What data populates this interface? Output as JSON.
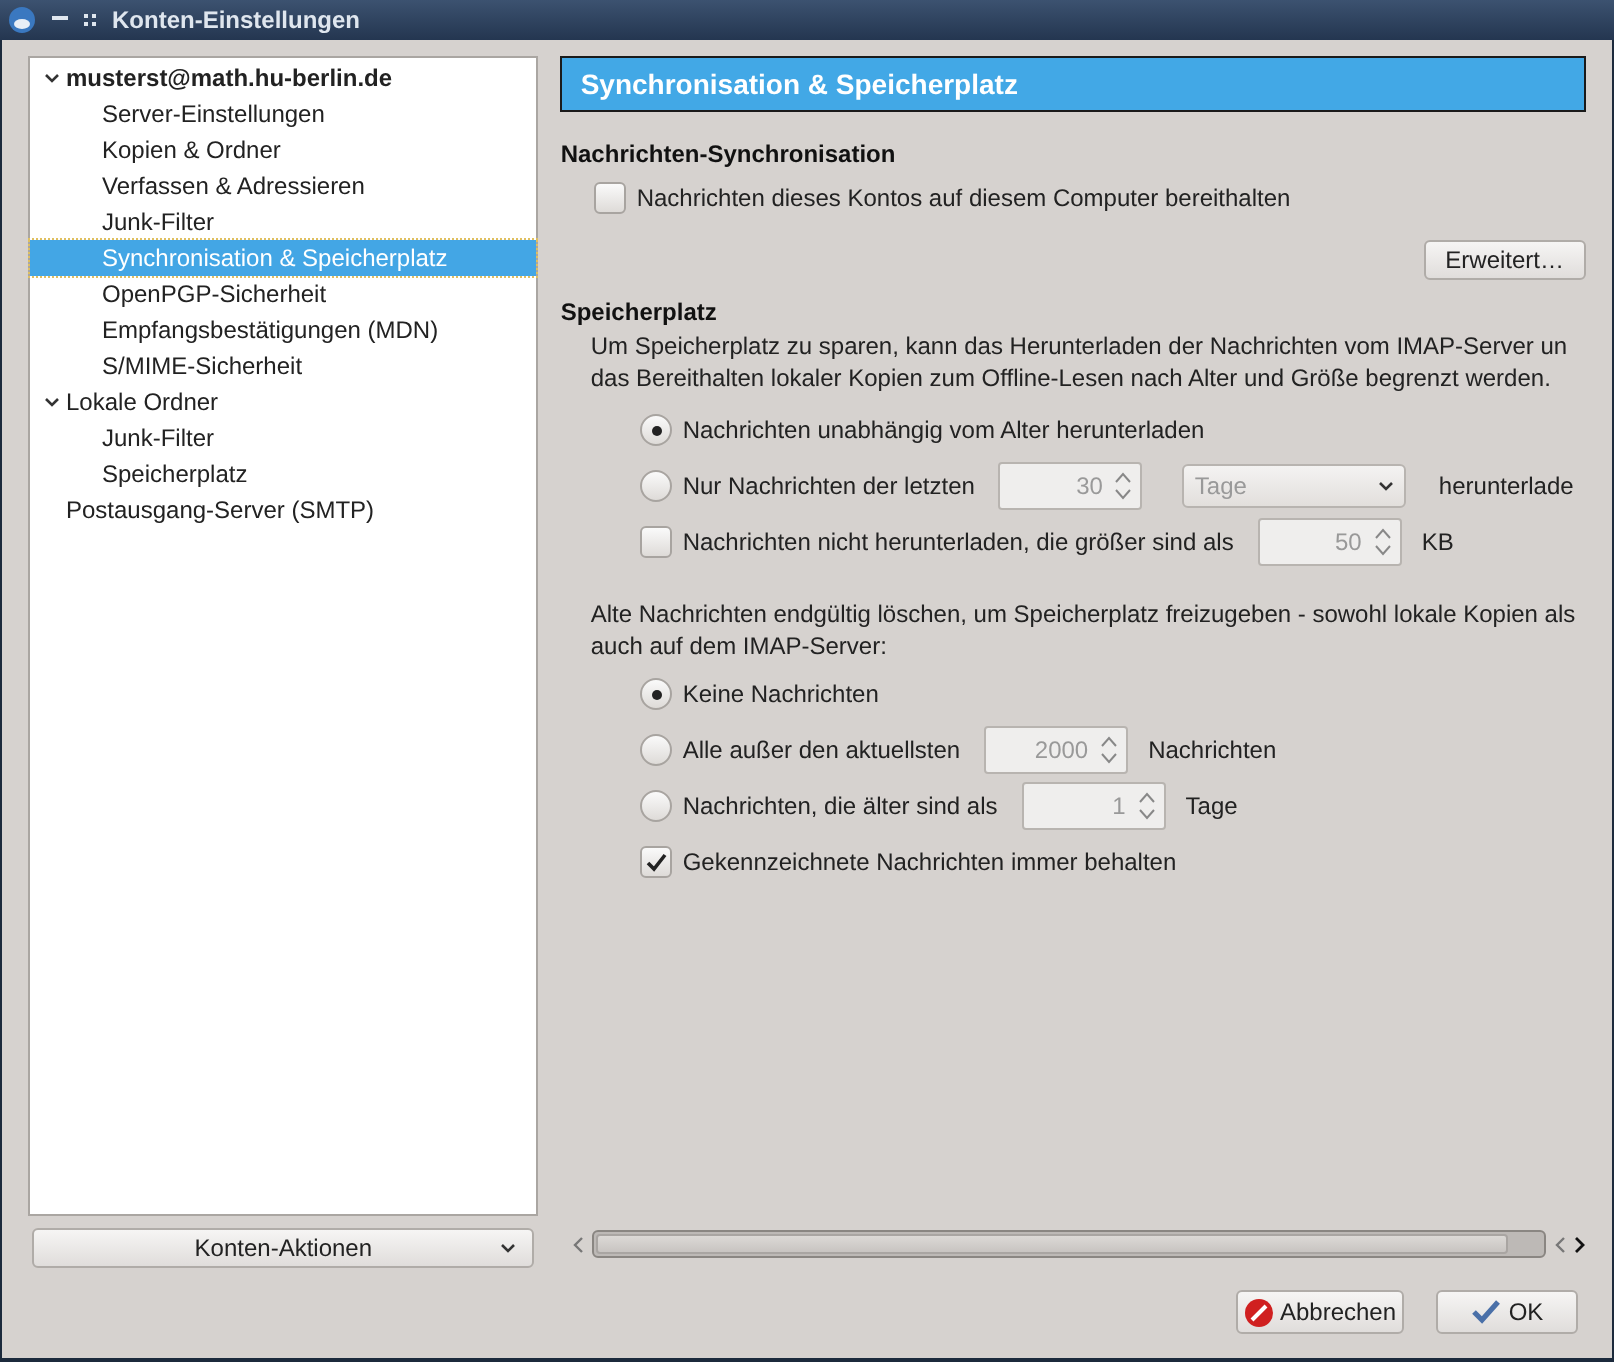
{
  "window": {
    "title": "Konten-Einstellungen"
  },
  "tree": [
    {
      "kind": "account",
      "label": "musterst@math.hu-berlin.de",
      "expanded": true,
      "selected": false,
      "children": [
        {
          "label": "Server-Einstellungen",
          "selected": false
        },
        {
          "label": "Kopien & Ordner",
          "selected": false
        },
        {
          "label": "Verfassen & Adressieren",
          "selected": false
        },
        {
          "label": "Junk-Filter",
          "selected": false
        },
        {
          "label": "Synchronisation & Speicherplatz",
          "selected": true
        },
        {
          "label": "OpenPGP-Sicherheit",
          "selected": false
        },
        {
          "label": "Empfangsbestätigungen (MDN)",
          "selected": false
        },
        {
          "label": "S/MIME-Sicherheit",
          "selected": false
        }
      ]
    },
    {
      "kind": "folder",
      "label": "Lokale Ordner",
      "expanded": true,
      "selected": false,
      "children": [
        {
          "label": "Junk-Filter",
          "selected": false
        },
        {
          "label": "Speicherplatz",
          "selected": false
        }
      ]
    },
    {
      "kind": "folder",
      "label": "Postausgang-Server (SMTP)",
      "selected": false
    }
  ],
  "account_actions": {
    "label": "Konten-Aktionen"
  },
  "page_header": "Synchronisation & Speicherplatz",
  "sync_section": {
    "heading": "Nachrichten-Synchronisation",
    "option": {
      "label": "Nachrichten dieses Kontos auf diesem Computer bereithalten",
      "checked": false
    },
    "advanced_button": "Erweitert…"
  },
  "storage_section": {
    "heading": "Speicherplatz",
    "description": "Um Speicherplatz zu sparen, kann das Herunterladen der Nachrichten vom IMAP-Server un das Bereithalten lokaler Kopien zum Offline-Lesen nach Alter und Größe begrenzt werden.",
    "download_options": [
      {
        "kind": "radio",
        "label": "Nachrichten unabhängig vom Alter herunterladen",
        "selected": true
      },
      {
        "kind": "radio",
        "label": "Nur Nachrichten der letzten",
        "selected": false,
        "spin": {
          "value": "30",
          "disabled": true
        },
        "select": {
          "value": "Tage",
          "disabled": true
        },
        "suffix": "herunterlade"
      },
      {
        "kind": "checkbox",
        "label": "Nachrichten nicht herunterladen, die größer sind als",
        "checked": false,
        "spin": {
          "value": "50",
          "disabled": true
        },
        "suffix": "KB"
      }
    ],
    "delete_description": "Alte Nachrichten endgültig löschen, um Speicherplatz freizugeben - sowohl lokale Kopien als auch auf dem IMAP-Server:",
    "delete_options": [
      {
        "kind": "radio",
        "label": "Keine Nachrichten",
        "selected": true
      },
      {
        "kind": "radio",
        "label": "Alle außer den aktuellsten",
        "selected": false,
        "spin": {
          "value": "2000",
          "disabled": true
        },
        "suffix": "Nachrichten"
      },
      {
        "kind": "radio",
        "label": "Nachrichten, die älter sind als",
        "selected": false,
        "spin": {
          "value": "1",
          "disabled": true
        },
        "suffix": "Tage"
      },
      {
        "kind": "checkbox",
        "label": "Gekennzeichnete Nachrichten immer behalten",
        "checked": true
      }
    ]
  },
  "buttons": [
    {
      "kind": "cancel",
      "label": "Abbrechen"
    },
    {
      "kind": "ok",
      "label": "OK"
    }
  ]
}
